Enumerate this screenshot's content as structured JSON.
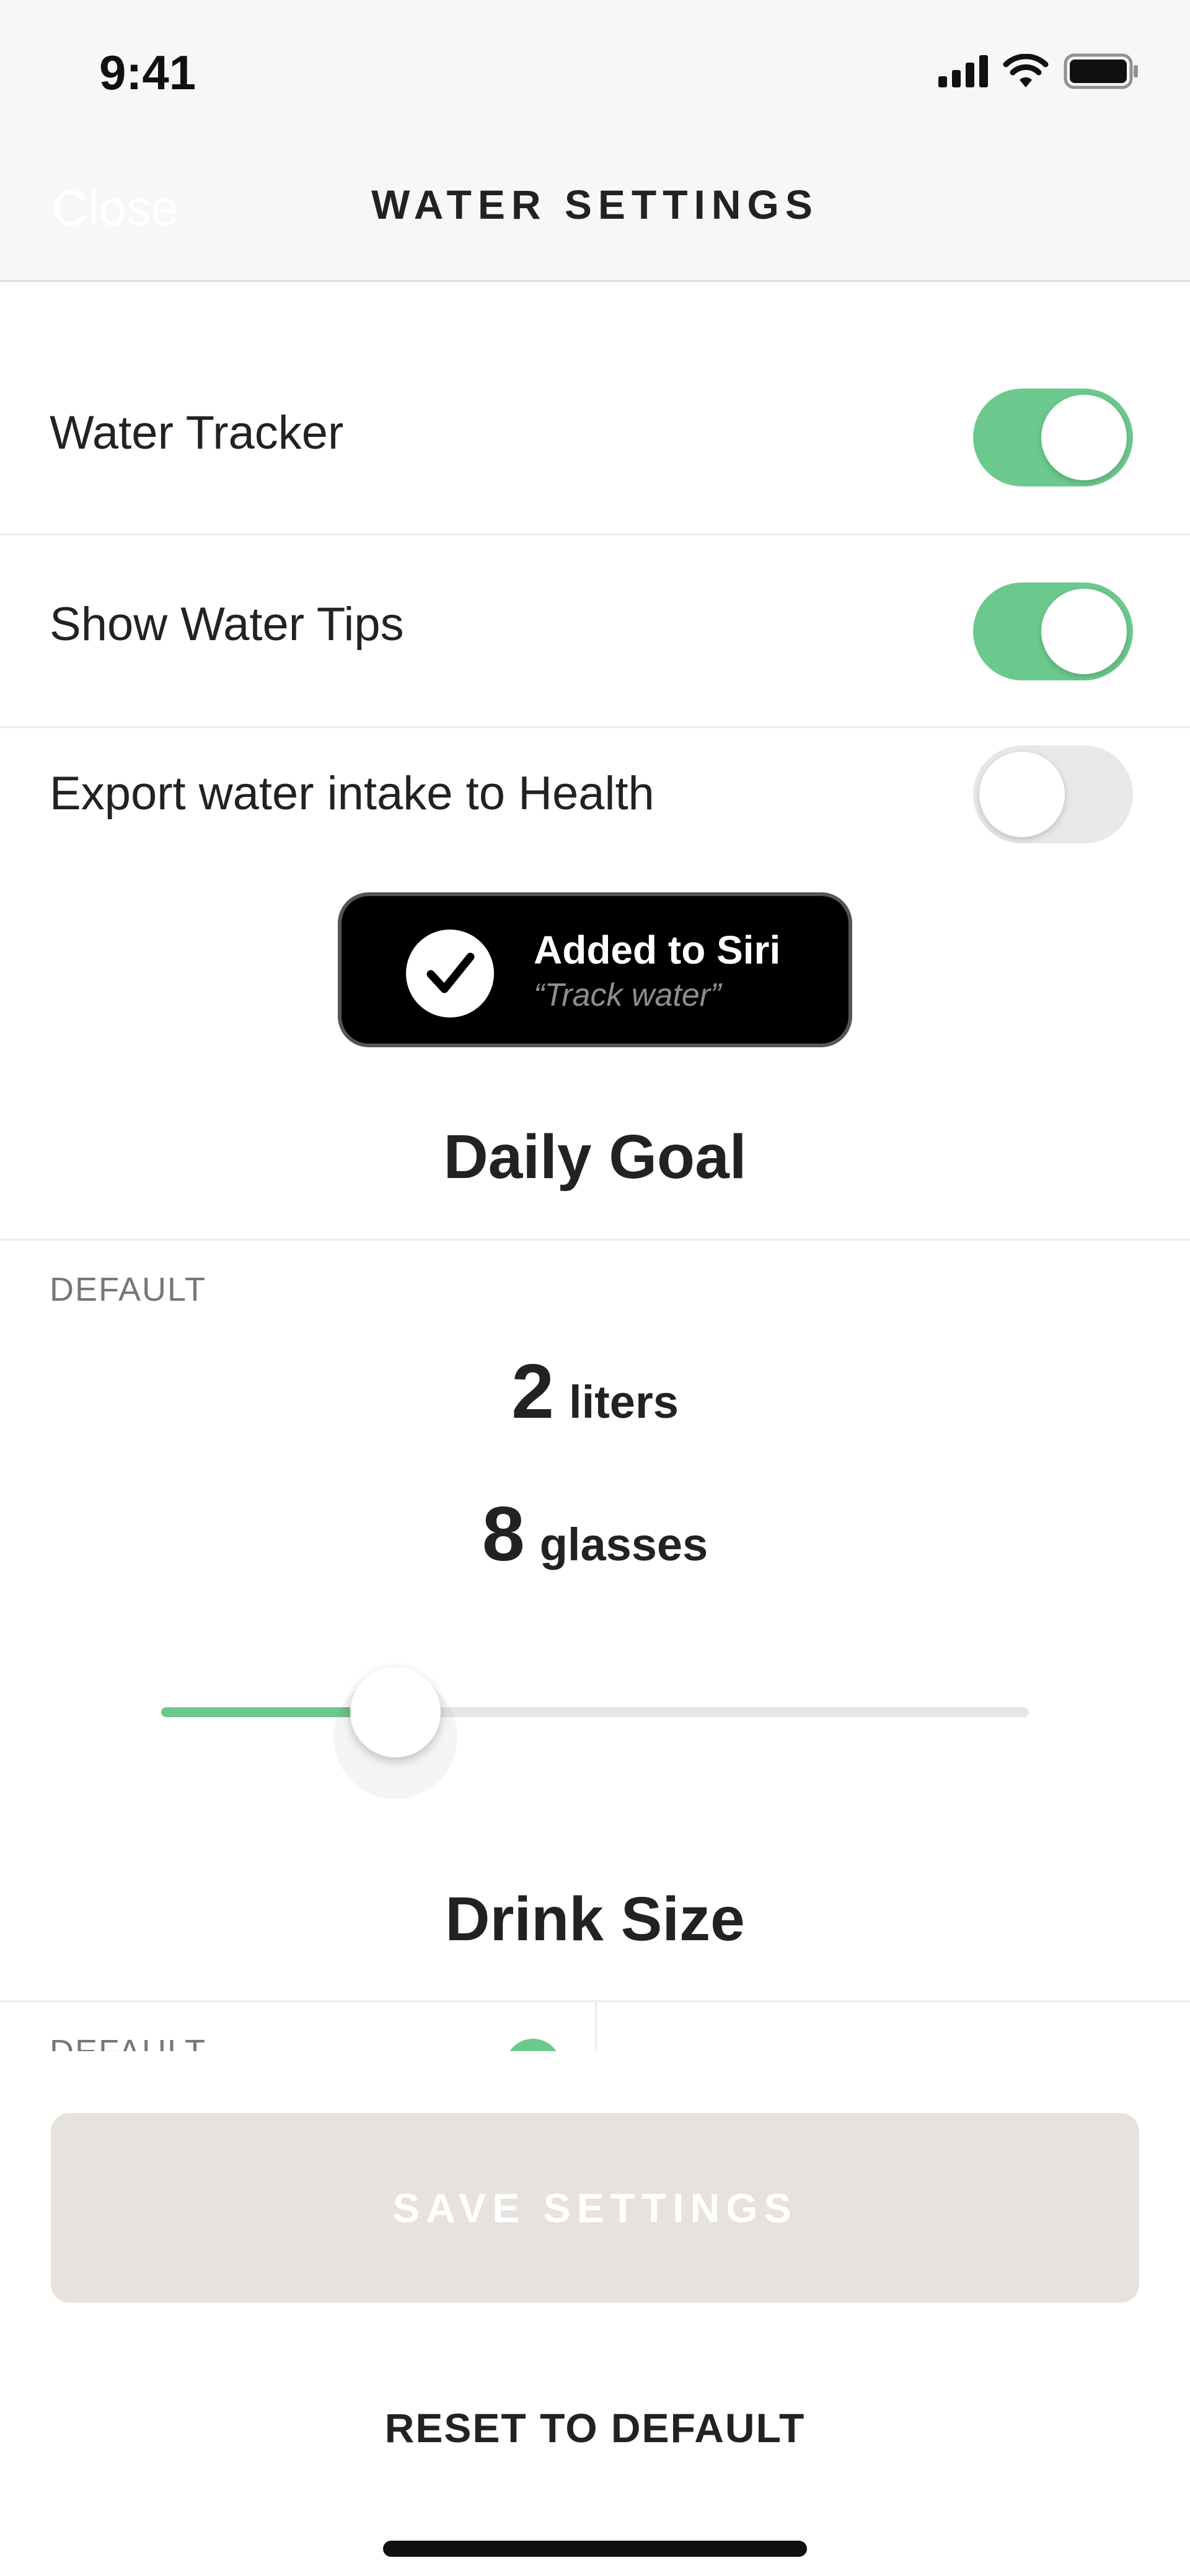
{
  "status_bar": {
    "time": "9:41",
    "icons": [
      "cellular-signal-icon",
      "wifi-icon",
      "battery-icon"
    ]
  },
  "nav": {
    "close_label": "Close",
    "title": "WATER SETTINGS"
  },
  "settings": [
    {
      "label": "Water Tracker",
      "enabled": true
    },
    {
      "label": "Show Water Tips",
      "enabled": true
    },
    {
      "label": "Export water intake to Health",
      "enabled": false
    }
  ],
  "siri": {
    "title": "Added to Siri",
    "phrase": "“Track water”",
    "icon": "checkmark-icon"
  },
  "daily_goal": {
    "title": "Daily Goal",
    "default_label": "DEFAULT",
    "liters_value": "2",
    "liters_unit": "liters",
    "glasses_value": "8",
    "glasses_unit": "glasses",
    "slider_fraction": 0.27
  },
  "drink_size": {
    "title": "Drink Size",
    "default_label": "DEFAULT"
  },
  "actions": {
    "save_label": "SAVE SETTINGS",
    "reset_label": "RESET TO DEFAULT"
  },
  "colors": {
    "accent": "#6cc98e",
    "toggle_off": "#e8e8e8",
    "save_disabled": "#e7e2dd"
  }
}
